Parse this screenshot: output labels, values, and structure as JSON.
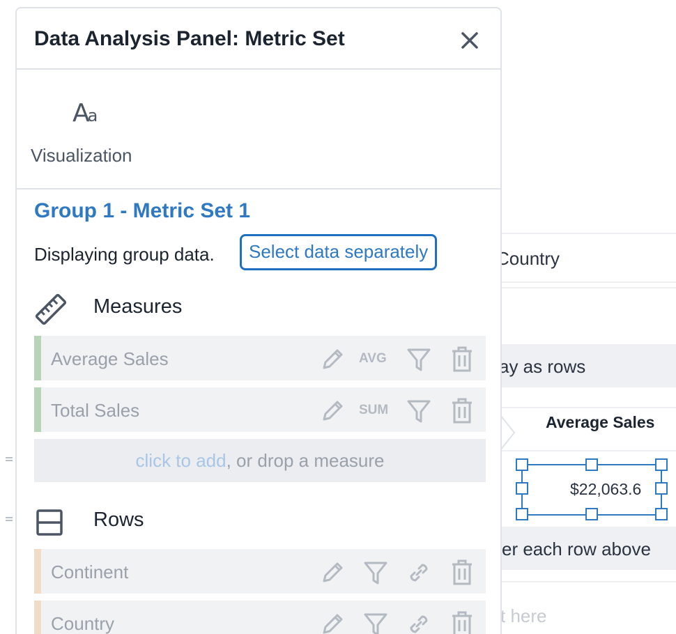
{
  "panel": {
    "title": "Data Analysis Panel: Metric Set",
    "visualization_label": "Visualization",
    "group_title": "Group 1 - Metric Set 1",
    "display_text": "Displaying group data.",
    "select_link": "Select data separately"
  },
  "measures": {
    "label": "Measures",
    "items": [
      {
        "label": "Average Sales",
        "aggregation": "AVG",
        "color": "#b7d4b8"
      },
      {
        "label": "Total Sales",
        "aggregation": "SUM",
        "color": "#b7d4b8"
      }
    ],
    "add_link": "click to add",
    "add_rest": ", or drop a measure"
  },
  "rows": {
    "label": "Rows",
    "items": [
      {
        "label": "Continent",
        "color": "#f2dcc7"
      },
      {
        "label": "Country",
        "color": "#f2dcc7"
      }
    ]
  },
  "background": {
    "country": "Country",
    "display_rows": "ay as rows",
    "column_header": "Average Sales",
    "cell_value": "$22,063.6",
    "each_row": "er each row above",
    "drop_hint": "t here"
  }
}
